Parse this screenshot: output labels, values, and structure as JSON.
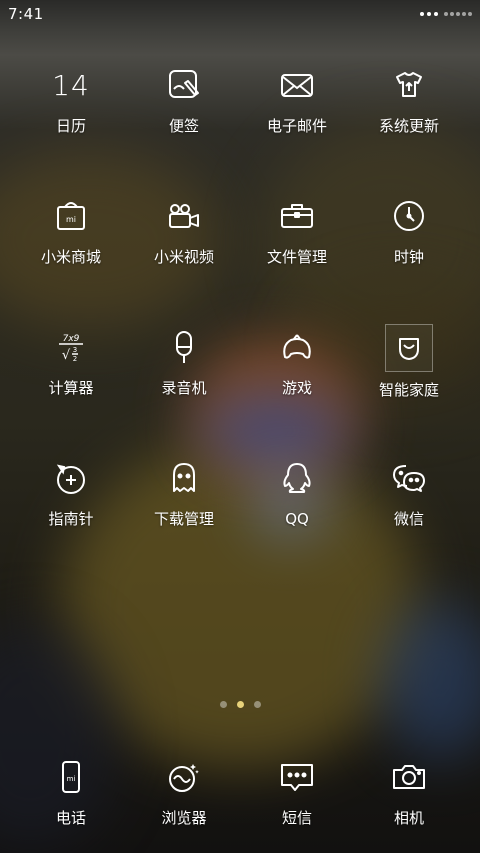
{
  "status_bar": {
    "time": "7:41"
  },
  "date_icon": {
    "day": "14"
  },
  "apps": [
    {
      "label": "日历",
      "icon": "calendar-icon"
    },
    {
      "label": "便签",
      "icon": "notes-icon"
    },
    {
      "label": "电子邮件",
      "icon": "mail-icon"
    },
    {
      "label": "系统更新",
      "icon": "system-update-icon"
    },
    {
      "label": "小米商城",
      "icon": "mi-store-icon"
    },
    {
      "label": "小米视频",
      "icon": "video-camera-icon"
    },
    {
      "label": "文件管理",
      "icon": "briefcase-icon"
    },
    {
      "label": "时钟",
      "icon": "clock-icon"
    },
    {
      "label": "计算器",
      "icon": "calculator-icon"
    },
    {
      "label": "录音机",
      "icon": "recorder-icon"
    },
    {
      "label": "游戏",
      "icon": "gamepad-icon"
    },
    {
      "label": "智能家庭",
      "icon": "mi-home-icon"
    },
    {
      "label": "指南针",
      "icon": "compass-icon"
    },
    {
      "label": "下载管理",
      "icon": "ghost-download-icon"
    },
    {
      "label": "QQ",
      "icon": "qq-penguin-icon"
    },
    {
      "label": "微信",
      "icon": "wechat-icon"
    }
  ],
  "calculator_icon": {
    "line1": "7x9",
    "line2": "√",
    "fraction_num": "3",
    "fraction_den": "2"
  },
  "mi_logo": "mi",
  "page_indicator": {
    "pages": 3,
    "active": 2
  },
  "dock": [
    {
      "label": "电话",
      "icon": "phone-icon"
    },
    {
      "label": "浏览器",
      "icon": "browser-icon"
    },
    {
      "label": "短信",
      "icon": "messages-icon"
    },
    {
      "label": "相机",
      "icon": "camera-icon"
    }
  ],
  "colors": {
    "page_active": "#e8d27a",
    "icon_stroke": "#ffffff"
  }
}
